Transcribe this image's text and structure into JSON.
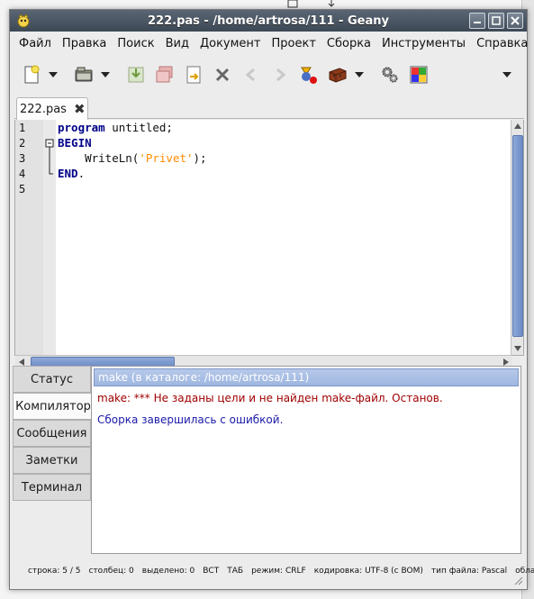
{
  "window": {
    "title": "222.pas - /home/artrosa/111 - Geany"
  },
  "menu": {
    "items": [
      "Файл",
      "Правка",
      "Поиск",
      "Вид",
      "Документ",
      "Проект",
      "Сборка",
      "Инструменты",
      "Справка"
    ]
  },
  "toolbar": {
    "icons": [
      "new-file-icon",
      "open-file-icon",
      "save-icon",
      "save-all-icon",
      "revert-icon",
      "close-file-icon",
      "navigate-back-icon",
      "navigate-forward-icon",
      "compile-icon",
      "build-icon",
      "preferences-icon",
      "color-chooser-icon"
    ]
  },
  "editor": {
    "tab_label": "222.pas",
    "line_numbers": [
      "1",
      "2",
      "3",
      "4",
      "5"
    ],
    "lines": [
      {
        "kw": "program",
        "rest": " untitled;"
      },
      {
        "kw": "BEGIN",
        "rest": ""
      },
      {
        "kw": "",
        "rest": "    WriteLn(",
        "str": "'Privet'",
        "tail": ");"
      },
      {
        "kw": "END",
        "rest": "."
      },
      {
        "kw": "",
        "rest": ""
      }
    ]
  },
  "bottom_tabs": [
    "Статус",
    "Компилятор",
    "Сообщения",
    "Заметки",
    "Терминал"
  ],
  "active_bottom_tab": "Компилятор",
  "compiler": {
    "header": "make (в каталоге: /home/artrosa/111)",
    "error": "make: *** Не заданы цели и не найден make-файл.  Останов.",
    "info": "Сборка завершилась с ошибкой."
  },
  "status": {
    "line": "строка: 5 / 5",
    "col": "столбец: 0",
    "sel": "выделено: 0",
    "ins": "ВСТ",
    "tab": "ТАБ",
    "mode": "режим: CRLF",
    "enc": "кодировка: UTF-8 (с BOM)",
    "ftype": "тип файла: Pascal",
    "scope": "обла..."
  },
  "colors": {
    "keyword": "#000088",
    "string": "#ff8c00",
    "error": "#a00000",
    "info": "#1a1aa8",
    "selection": "#9fb6e0"
  }
}
